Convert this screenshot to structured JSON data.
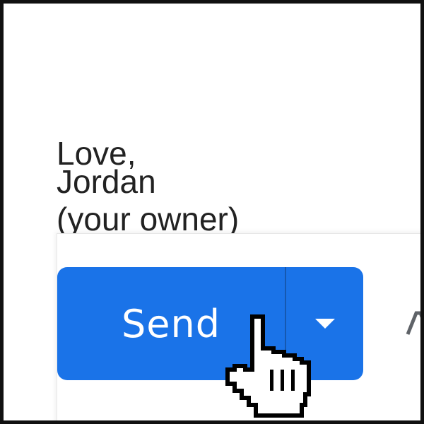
{
  "message": {
    "lines": [
      "Love,",
      "Jordan",
      "(your owner)"
    ]
  },
  "compose_toolbar": {
    "send_label": "Send",
    "send_color": "#1a73e8",
    "more_options_icon": "caret-down-icon",
    "next_tool_icon": "format-text-icon"
  },
  "cursor": {
    "icon": "hand-pointer-icon"
  }
}
